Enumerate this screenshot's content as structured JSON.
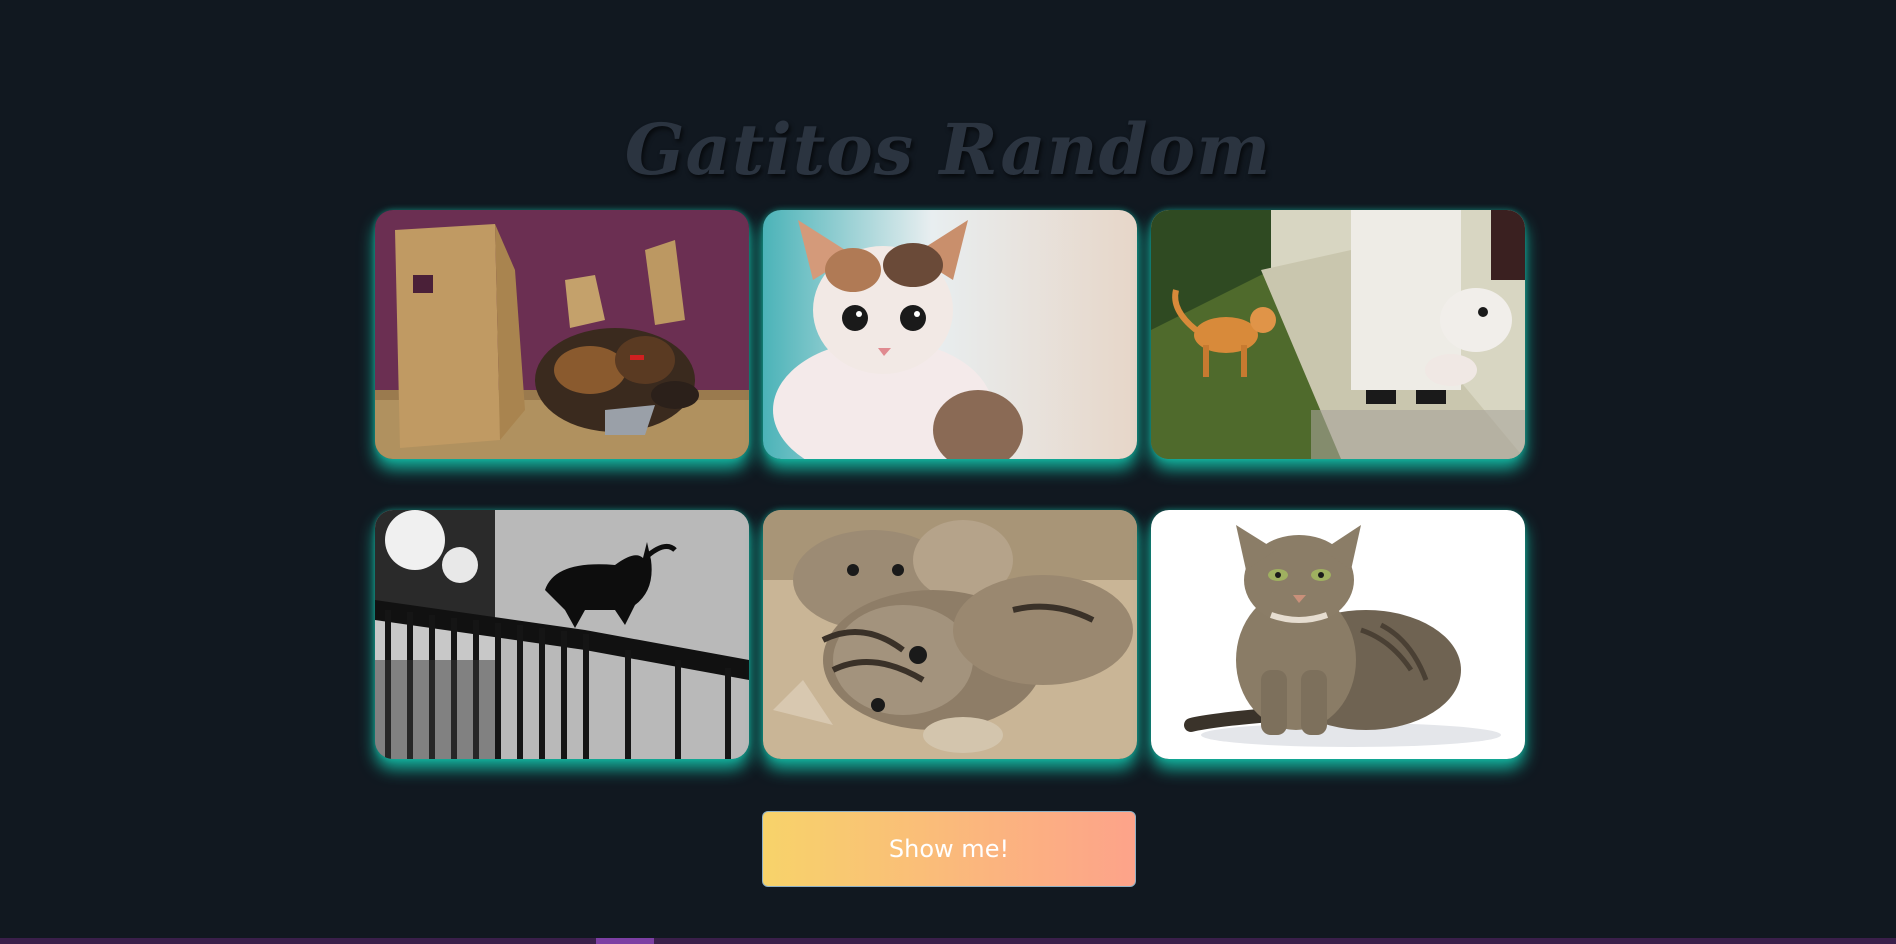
{
  "page": {
    "title": "Gatitos Random"
  },
  "gallery": {
    "images": [
      {
        "alt": "cat-in-cardboard-box"
      },
      {
        "alt": "calico-kitten"
      },
      {
        "alt": "orange-cat-street"
      },
      {
        "alt": "black-cat-silhouette"
      },
      {
        "alt": "tabby-kittens"
      },
      {
        "alt": "tabby-cat-white-background"
      }
    ]
  },
  "actions": {
    "show_label": "Show me!"
  },
  "colors": {
    "background": "#111820",
    "glow": "#14c8af",
    "button_start": "#f7d36a",
    "button_end": "#fda38a",
    "title": "#2b3440"
  }
}
